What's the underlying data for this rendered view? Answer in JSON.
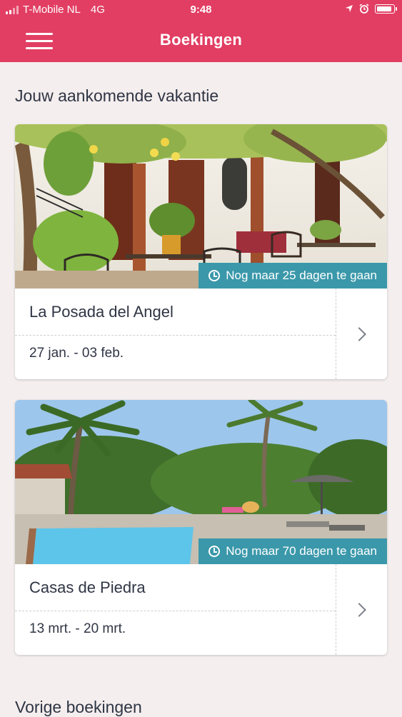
{
  "statusbar": {
    "carrier": "T-Mobile NL",
    "network": "4G",
    "time": "9:48",
    "icons": [
      "signal-icon",
      "location-arrow-icon",
      "alarm-icon",
      "battery-icon"
    ],
    "battery_level": 1.0
  },
  "header": {
    "title": "Boekingen",
    "menu_icon": "hamburger-menu-icon",
    "background": "#e23e63"
  },
  "upcoming": {
    "heading": "Jouw aankomende vakantie",
    "bookings": [
      {
        "name": "La Posada del Angel",
        "dates": "27 jan. - 03 feb.",
        "countdown": "Nog maar 25 dagen te gaan",
        "image": "courtyard-patio-photo"
      },
      {
        "name": "Casas de Piedra",
        "dates": "13 mrt. - 20 mrt.",
        "countdown": "Nog maar 70 dagen te gaan",
        "image": "pool-palm-trees-photo"
      }
    ]
  },
  "previous": {
    "heading": "Vorige boekingen"
  },
  "colors": {
    "accent": "#e23e63",
    "badge": "#3a98aa",
    "background": "#f4eeee",
    "text": "#2f3544"
  }
}
